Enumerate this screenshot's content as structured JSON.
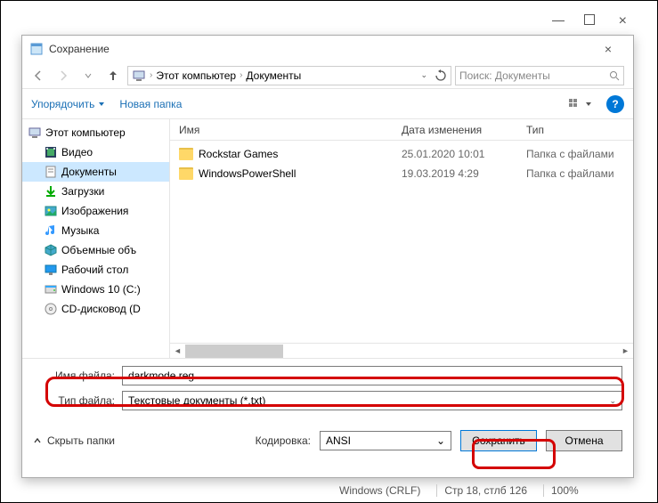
{
  "window": {
    "title": "Сохранение"
  },
  "breadcrumb": {
    "root": "Этот компьютер",
    "folder": "Документы"
  },
  "search": {
    "placeholder": "Поиск: Документы"
  },
  "toolbar": {
    "organize": "Упорядочить",
    "newfolder": "Новая папка"
  },
  "columns": {
    "name": "Имя",
    "date": "Дата изменения",
    "type": "Тип"
  },
  "tree": [
    {
      "label": "Этот компьютер",
      "icon": "pc",
      "sub": false,
      "sel": false
    },
    {
      "label": "Видео",
      "icon": "video",
      "sub": true,
      "sel": false
    },
    {
      "label": "Документы",
      "icon": "doc",
      "sub": true,
      "sel": true
    },
    {
      "label": "Загрузки",
      "icon": "down",
      "sub": true,
      "sel": false
    },
    {
      "label": "Изображения",
      "icon": "img",
      "sub": true,
      "sel": false
    },
    {
      "label": "Музыка",
      "icon": "music",
      "sub": true,
      "sel": false
    },
    {
      "label": "Объемные объ",
      "icon": "cube",
      "sub": true,
      "sel": false
    },
    {
      "label": "Рабочий стол",
      "icon": "desk",
      "sub": true,
      "sel": false
    },
    {
      "label": "Windows 10 (C:)",
      "icon": "disk",
      "sub": true,
      "sel": false
    },
    {
      "label": "CD-дисковод (D",
      "icon": "cd",
      "sub": true,
      "sel": false
    }
  ],
  "files": [
    {
      "name": "Rockstar Games",
      "date": "25.01.2020 10:01",
      "type": "Папка с файлами"
    },
    {
      "name": "WindowsPowerShell",
      "date": "19.03.2019 4:29",
      "type": "Папка с файлами"
    }
  ],
  "labels": {
    "filename": "Имя файла:",
    "filetype": "Тип файла:",
    "encoding": "Кодировка:",
    "hide": "Скрыть папки"
  },
  "filename": "darkmode.reg",
  "filetype": "Текстовые документы (*.txt)",
  "encoding": "ANSI",
  "buttons": {
    "save": "Сохранить",
    "cancel": "Отмена"
  },
  "status": {
    "eol": "Windows (CRLF)",
    "pos": "Стр 18, стлб 126",
    "zoom": "100%"
  }
}
